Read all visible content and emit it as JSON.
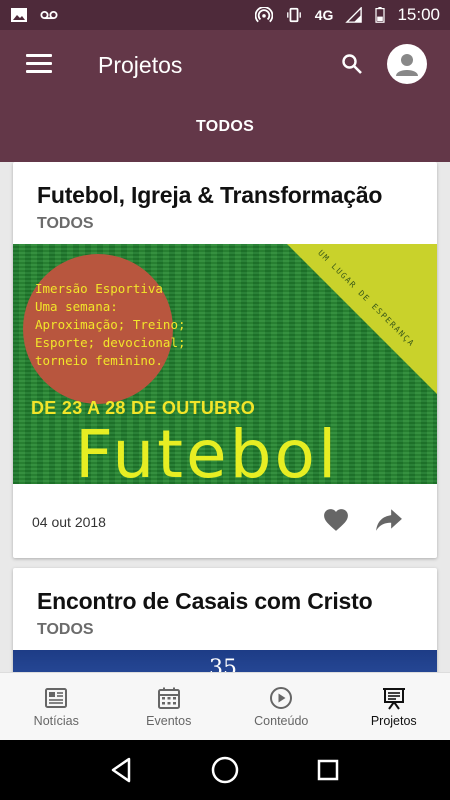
{
  "status_bar": {
    "network": "4G",
    "time": "15:00",
    "icons": [
      "image-icon",
      "voicemail-icon",
      "hotspot-icon",
      "vibrate-icon",
      "signal-icon",
      "battery-icon"
    ]
  },
  "app_bar": {
    "title": "Projetos",
    "active_tab": "TODOS",
    "icons": [
      "menu-icon",
      "search-icon",
      "account-icon"
    ]
  },
  "cards": [
    {
      "title": "Futebol, Igreja & Transformação",
      "category": "TODOS",
      "image": {
        "corner_text": "UM LUGAR DE ESPERANÇA",
        "lines": [
          "Imersão Esportiva",
          "Uma semana:",
          "Aproximação; Treino;",
          "Esporte; devocional;",
          "torneio feminino."
        ],
        "dates": "DE 23 A 28 DE OUTUBRO",
        "big_text": "Futebol"
      },
      "date": "04 out 2018",
      "actions": [
        "heart-icon",
        "share-icon"
      ]
    },
    {
      "title": "Encontro de Casais com Cristo",
      "category": "TODOS",
      "image": {
        "number": "35"
      }
    }
  ],
  "bottom_nav": [
    {
      "label": "Notícias",
      "icon": "news-icon"
    },
    {
      "label": "Eventos",
      "icon": "calendar-icon"
    },
    {
      "label": "Conteúdo",
      "icon": "play-icon"
    },
    {
      "label": "Projetos",
      "icon": "presentation-icon",
      "active": true
    }
  ],
  "colors": {
    "primary": "#633748",
    "status_bar": "#4e2a3a",
    "image_text": "#f2e52a"
  }
}
